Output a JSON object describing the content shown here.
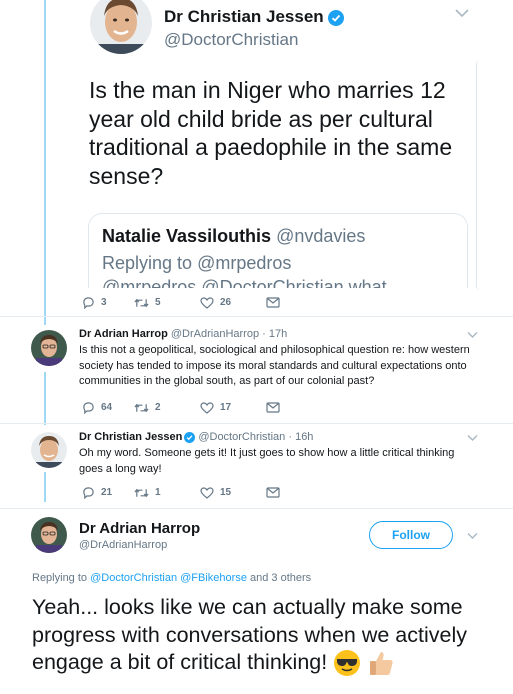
{
  "top_tweet": {
    "name": "Dr Christian Jessen",
    "handle": "@DoctorChristian",
    "text": "Is the man in Niger who marries 12 year old child bride as per cultural traditional a paedophile in the same sense?",
    "quote": {
      "name": "Natalie Vassilouthis",
      "handle": "@nvdavies",
      "replying_prefix": "Replying to",
      "replying_to": "@mrpedros",
      "cut_text": "@mrpedros @DoctorChristian what"
    },
    "counts": {
      "replies": "3",
      "retweets": "5",
      "likes": "26"
    }
  },
  "reply1": {
    "name": "Dr Adrian Harrop",
    "meta": "@DrAdrianHarrop · 17h",
    "text": "Is this not a geopolitical, sociological and philosophical question re: how western society has tended to impose its moral standards and cultural expectations onto communities in the global south, as part of our colonial past?",
    "counts": {
      "replies": "64",
      "retweets": "2",
      "likes": "17"
    }
  },
  "reply2": {
    "name": "Dr Christian Jessen",
    "meta": "@DoctorChristian · 16h",
    "text": "Oh my word. Someone gets it! It just goes to show how a little critical thinking goes a long way!",
    "counts": {
      "replies": "21",
      "retweets": "1",
      "likes": "15"
    }
  },
  "main_tweet": {
    "name": "Dr Adrian Harrop",
    "handle": "@DrAdrianHarrop",
    "follow_label": "Follow",
    "replying_prefix": "Replying to",
    "replying_links": "@DoctorChristian @FBikehorse",
    "replying_suffix": "and 3 others",
    "text": "Yeah... looks like we can actually make some progress with conversations when we actively engage a bit of critical thinking!"
  },
  "icons": {
    "reply": "reply-icon",
    "retweet": "retweet-icon",
    "like": "heart-icon",
    "dm": "message-icon",
    "verified": "verified-badge-icon",
    "caret": "chevron-down-icon",
    "emoji_1": "sunglasses-emoji",
    "emoji_2": "thumbs-up-emoji"
  },
  "colors": {
    "accent": "#1da1f2",
    "secondary": "#657786",
    "thread_line": "#9fd8f5"
  }
}
